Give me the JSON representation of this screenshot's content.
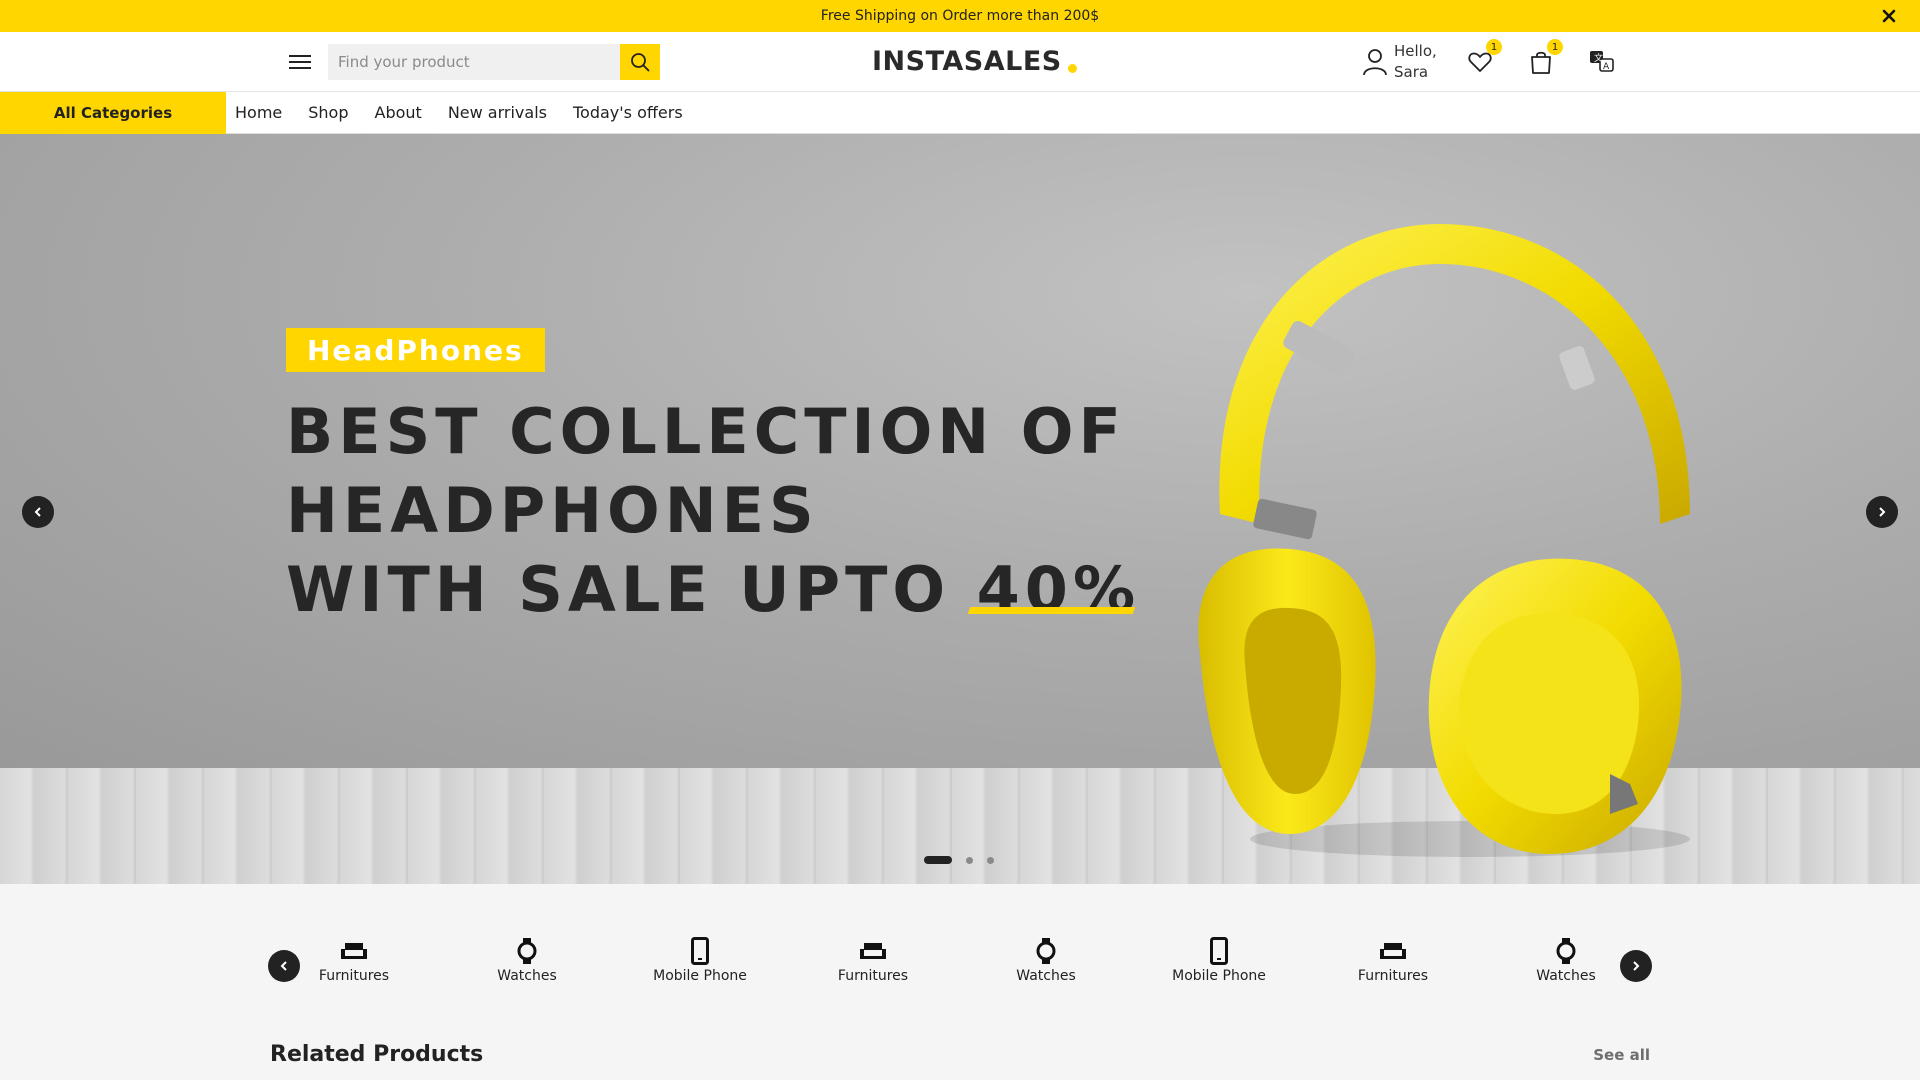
{
  "promo": {
    "text": "Free Shipping on Order more than 200$"
  },
  "header": {
    "search_placeholder": "Find your product",
    "logo": "INSTASALES",
    "user_greeting": "Hello,",
    "user_name": "Sara",
    "wishlist_count": "1",
    "cart_count": "1"
  },
  "nav": {
    "all_categories": "All Categories",
    "links": [
      "Home",
      "Shop",
      "About",
      "New arrivals",
      "Today's offers"
    ]
  },
  "hero": {
    "tag": "HeadPhones",
    "line1": "BEST COLLECTION OF",
    "line2": "HEADPHONES",
    "line3_prefix": "WITH SALE UPTO ",
    "line3_highlight": "40%",
    "slide_count": 3,
    "active_slide": 1
  },
  "categories": [
    {
      "label": "Furnitures",
      "icon": "sofa-icon"
    },
    {
      "label": "Watches",
      "icon": "watch-icon"
    },
    {
      "label": "Mobile Phone",
      "icon": "mobile-phone-icon"
    },
    {
      "label": "Furnitures",
      "icon": "sofa-icon"
    },
    {
      "label": "Watches",
      "icon": "watch-icon"
    },
    {
      "label": "Mobile Phone",
      "icon": "mobile-phone-icon"
    },
    {
      "label": "Furnitures",
      "icon": "sofa-icon"
    },
    {
      "label": "Watches",
      "icon": "watch-icon"
    }
  ],
  "related": {
    "title": "Related Products",
    "see_all": "See all"
  },
  "colors": {
    "accent": "#ffd600",
    "dark": "#222222"
  }
}
